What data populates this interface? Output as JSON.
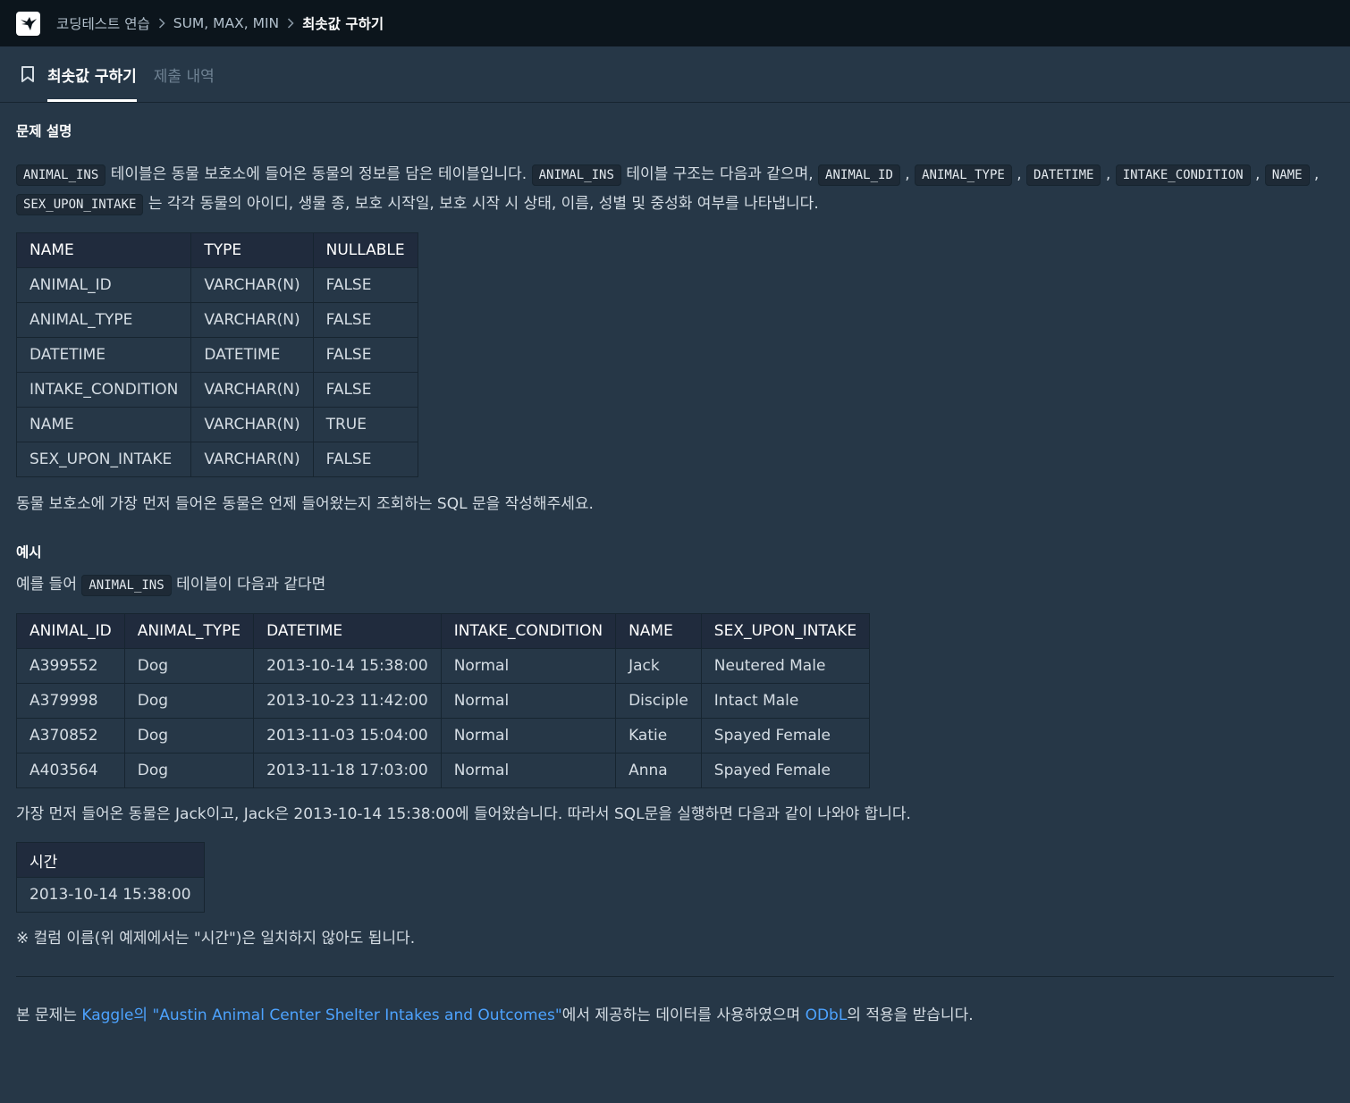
{
  "breadcrumb": {
    "items": [
      "코딩테스트 연습",
      "SUM, MAX, MIN"
    ],
    "current": "최솟값 구하기"
  },
  "tabs": [
    {
      "label": "최솟값 구하기",
      "active": true
    },
    {
      "label": "제출 내역",
      "active": false
    }
  ],
  "problem": {
    "heading": "문제 설명",
    "intro": [
      {
        "type": "code",
        "text": "ANIMAL_INS"
      },
      {
        "type": "text",
        "text": " 테이블은 동물 보호소에 들어온 동물의 정보를 담은 테이블입니다. "
      },
      {
        "type": "code",
        "text": "ANIMAL_INS"
      },
      {
        "type": "text",
        "text": " 테이블 구조는 다음과 같으며, "
      },
      {
        "type": "code",
        "text": "ANIMAL_ID"
      },
      {
        "type": "text",
        "text": " , "
      },
      {
        "type": "code",
        "text": "ANIMAL_TYPE"
      },
      {
        "type": "text",
        "text": " , "
      },
      {
        "type": "code",
        "text": "DATETIME"
      },
      {
        "type": "text",
        "text": " , "
      },
      {
        "type": "code",
        "text": "INTAKE_CONDITION"
      },
      {
        "type": "text",
        "text": " , "
      },
      {
        "type": "code",
        "text": "NAME"
      },
      {
        "type": "text",
        "text": " , "
      },
      {
        "type": "code",
        "text": "SEX_UPON_INTAKE"
      },
      {
        "type": "text",
        "text": " 는 각각 동물의 아이디, 생물 종, 보호 시작일, 보호 시작 시 상태, 이름, 성별 및 중성화 여부를 나타냅니다."
      }
    ],
    "schema_table": {
      "headers": [
        "NAME",
        "TYPE",
        "NULLABLE"
      ],
      "rows": [
        [
          "ANIMAL_ID",
          "VARCHAR(N)",
          "FALSE"
        ],
        [
          "ANIMAL_TYPE",
          "VARCHAR(N)",
          "FALSE"
        ],
        [
          "DATETIME",
          "DATETIME",
          "FALSE"
        ],
        [
          "INTAKE_CONDITION",
          "VARCHAR(N)",
          "FALSE"
        ],
        [
          "NAME",
          "VARCHAR(N)",
          "TRUE"
        ],
        [
          "SEX_UPON_INTAKE",
          "VARCHAR(N)",
          "FALSE"
        ]
      ]
    },
    "question": "동물 보호소에 가장 먼저 들어온 동물은 언제 들어왔는지 조회하는 SQL 문을 작성해주세요."
  },
  "example": {
    "heading": "예시",
    "intro_before": "예를 들어 ",
    "intro_code": "ANIMAL_INS",
    "intro_after": " 테이블이 다음과 같다면",
    "data_table": {
      "headers": [
        "ANIMAL_ID",
        "ANIMAL_TYPE",
        "DATETIME",
        "INTAKE_CONDITION",
        "NAME",
        "SEX_UPON_INTAKE"
      ],
      "rows": [
        [
          "A399552",
          "Dog",
          "2013-10-14 15:38:00",
          "Normal",
          "Jack",
          "Neutered Male"
        ],
        [
          "A379998",
          "Dog",
          "2013-10-23 11:42:00",
          "Normal",
          "Disciple",
          "Intact Male"
        ],
        [
          "A370852",
          "Dog",
          "2013-11-03 15:04:00",
          "Normal",
          "Katie",
          "Spayed Female"
        ],
        [
          "A403564",
          "Dog",
          "2013-11-18 17:03:00",
          "Normal",
          "Anna",
          "Spayed Female"
        ]
      ]
    },
    "explanation": "가장 먼저 들어온 동물은 Jack이고, Jack은 2013-10-14 15:38:00에 들어왔습니다. 따라서 SQL문을 실행하면 다음과 같이 나와야 합니다.",
    "result_table": {
      "headers": [
        "시간"
      ],
      "rows": [
        [
          "2013-10-14 15:38:00"
        ]
      ]
    },
    "note": "※ 컬럼 이름(위 예제에서는 \"시간\")은 일치하지 않아도 됩니다."
  },
  "footer": {
    "prefix": "본 문제는 ",
    "link1": "Kaggle의 \"Austin Animal Center Shelter Intakes and Outcomes\"",
    "middle": "에서 제공하는 데이터를 사용하였으며 ",
    "link2": "ODbL",
    "suffix": "의 적용을 받습니다."
  },
  "colors": {
    "background": "#263747",
    "topbar": "#0c151c",
    "table_header": "#202b3d",
    "link": "#4da3ff"
  },
  "icons": {
    "logo": "programmers-logo-icon",
    "bookmark": "bookmark-icon",
    "chevron": "chevron-right-icon"
  }
}
